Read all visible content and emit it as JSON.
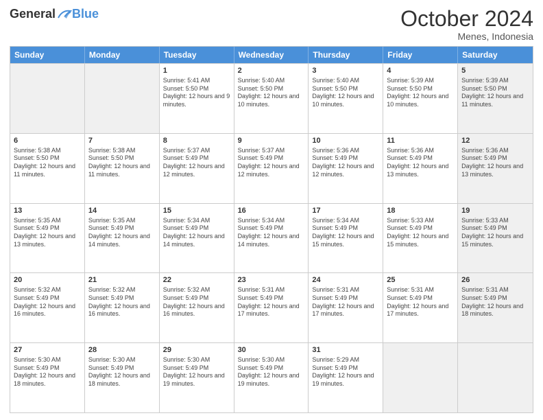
{
  "logo": {
    "general": "General",
    "blue": "Blue"
  },
  "title": "October 2024",
  "location": "Menes, Indonesia",
  "days": [
    "Sunday",
    "Monday",
    "Tuesday",
    "Wednesday",
    "Thursday",
    "Friday",
    "Saturday"
  ],
  "weeks": [
    [
      {
        "day": "",
        "info": "",
        "shaded": true
      },
      {
        "day": "",
        "info": "",
        "shaded": true
      },
      {
        "day": "1",
        "info": "Sunrise: 5:41 AM\nSunset: 5:50 PM\nDaylight: 12 hours and 9 minutes.",
        "shaded": false
      },
      {
        "day": "2",
        "info": "Sunrise: 5:40 AM\nSunset: 5:50 PM\nDaylight: 12 hours and 10 minutes.",
        "shaded": false
      },
      {
        "day": "3",
        "info": "Sunrise: 5:40 AM\nSunset: 5:50 PM\nDaylight: 12 hours and 10 minutes.",
        "shaded": false
      },
      {
        "day": "4",
        "info": "Sunrise: 5:39 AM\nSunset: 5:50 PM\nDaylight: 12 hours and 10 minutes.",
        "shaded": false
      },
      {
        "day": "5",
        "info": "Sunrise: 5:39 AM\nSunset: 5:50 PM\nDaylight: 12 hours and 11 minutes.",
        "shaded": true
      }
    ],
    [
      {
        "day": "6",
        "info": "Sunrise: 5:38 AM\nSunset: 5:50 PM\nDaylight: 12 hours and 11 minutes.",
        "shaded": false
      },
      {
        "day": "7",
        "info": "Sunrise: 5:38 AM\nSunset: 5:50 PM\nDaylight: 12 hours and 11 minutes.",
        "shaded": false
      },
      {
        "day": "8",
        "info": "Sunrise: 5:37 AM\nSunset: 5:49 PM\nDaylight: 12 hours and 12 minutes.",
        "shaded": false
      },
      {
        "day": "9",
        "info": "Sunrise: 5:37 AM\nSunset: 5:49 PM\nDaylight: 12 hours and 12 minutes.",
        "shaded": false
      },
      {
        "day": "10",
        "info": "Sunrise: 5:36 AM\nSunset: 5:49 PM\nDaylight: 12 hours and 12 minutes.",
        "shaded": false
      },
      {
        "day": "11",
        "info": "Sunrise: 5:36 AM\nSunset: 5:49 PM\nDaylight: 12 hours and 13 minutes.",
        "shaded": false
      },
      {
        "day": "12",
        "info": "Sunrise: 5:36 AM\nSunset: 5:49 PM\nDaylight: 12 hours and 13 minutes.",
        "shaded": true
      }
    ],
    [
      {
        "day": "13",
        "info": "Sunrise: 5:35 AM\nSunset: 5:49 PM\nDaylight: 12 hours and 13 minutes.",
        "shaded": false
      },
      {
        "day": "14",
        "info": "Sunrise: 5:35 AM\nSunset: 5:49 PM\nDaylight: 12 hours and 14 minutes.",
        "shaded": false
      },
      {
        "day": "15",
        "info": "Sunrise: 5:34 AM\nSunset: 5:49 PM\nDaylight: 12 hours and 14 minutes.",
        "shaded": false
      },
      {
        "day": "16",
        "info": "Sunrise: 5:34 AM\nSunset: 5:49 PM\nDaylight: 12 hours and 14 minutes.",
        "shaded": false
      },
      {
        "day": "17",
        "info": "Sunrise: 5:34 AM\nSunset: 5:49 PM\nDaylight: 12 hours and 15 minutes.",
        "shaded": false
      },
      {
        "day": "18",
        "info": "Sunrise: 5:33 AM\nSunset: 5:49 PM\nDaylight: 12 hours and 15 minutes.",
        "shaded": false
      },
      {
        "day": "19",
        "info": "Sunrise: 5:33 AM\nSunset: 5:49 PM\nDaylight: 12 hours and 15 minutes.",
        "shaded": true
      }
    ],
    [
      {
        "day": "20",
        "info": "Sunrise: 5:32 AM\nSunset: 5:49 PM\nDaylight: 12 hours and 16 minutes.",
        "shaded": false
      },
      {
        "day": "21",
        "info": "Sunrise: 5:32 AM\nSunset: 5:49 PM\nDaylight: 12 hours and 16 minutes.",
        "shaded": false
      },
      {
        "day": "22",
        "info": "Sunrise: 5:32 AM\nSunset: 5:49 PM\nDaylight: 12 hours and 16 minutes.",
        "shaded": false
      },
      {
        "day": "23",
        "info": "Sunrise: 5:31 AM\nSunset: 5:49 PM\nDaylight: 12 hours and 17 minutes.",
        "shaded": false
      },
      {
        "day": "24",
        "info": "Sunrise: 5:31 AM\nSunset: 5:49 PM\nDaylight: 12 hours and 17 minutes.",
        "shaded": false
      },
      {
        "day": "25",
        "info": "Sunrise: 5:31 AM\nSunset: 5:49 PM\nDaylight: 12 hours and 17 minutes.",
        "shaded": false
      },
      {
        "day": "26",
        "info": "Sunrise: 5:31 AM\nSunset: 5:49 PM\nDaylight: 12 hours and 18 minutes.",
        "shaded": true
      }
    ],
    [
      {
        "day": "27",
        "info": "Sunrise: 5:30 AM\nSunset: 5:49 PM\nDaylight: 12 hours and 18 minutes.",
        "shaded": false
      },
      {
        "day": "28",
        "info": "Sunrise: 5:30 AM\nSunset: 5:49 PM\nDaylight: 12 hours and 18 minutes.",
        "shaded": false
      },
      {
        "day": "29",
        "info": "Sunrise: 5:30 AM\nSunset: 5:49 PM\nDaylight: 12 hours and 19 minutes.",
        "shaded": false
      },
      {
        "day": "30",
        "info": "Sunrise: 5:30 AM\nSunset: 5:49 PM\nDaylight: 12 hours and 19 minutes.",
        "shaded": false
      },
      {
        "day": "31",
        "info": "Sunrise: 5:29 AM\nSunset: 5:49 PM\nDaylight: 12 hours and 19 minutes.",
        "shaded": false
      },
      {
        "day": "",
        "info": "",
        "shaded": true
      },
      {
        "day": "",
        "info": "",
        "shaded": true
      }
    ]
  ]
}
